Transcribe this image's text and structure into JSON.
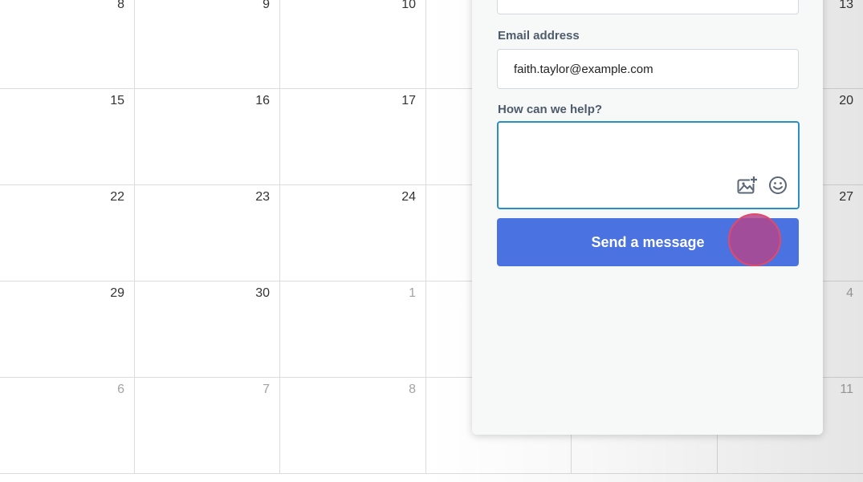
{
  "calendar": {
    "rows": [
      [
        {
          "day": "8",
          "muted": false
        },
        {
          "day": "9",
          "muted": false
        },
        {
          "day": "10",
          "muted": false
        },
        {
          "day": "",
          "muted": false
        },
        {
          "day": "",
          "muted": false
        },
        {
          "day": "13",
          "muted": false
        }
      ],
      [
        {
          "day": "15",
          "muted": false
        },
        {
          "day": "16",
          "muted": false
        },
        {
          "day": "17",
          "muted": false
        },
        {
          "day": "",
          "muted": false
        },
        {
          "day": "",
          "muted": false
        },
        {
          "day": "20",
          "muted": false
        }
      ],
      [
        {
          "day": "22",
          "muted": false
        },
        {
          "day": "23",
          "muted": false
        },
        {
          "day": "24",
          "muted": false
        },
        {
          "day": "",
          "muted": false
        },
        {
          "day": "",
          "muted": false
        },
        {
          "day": "27",
          "muted": false
        }
      ],
      [
        {
          "day": "29",
          "muted": false
        },
        {
          "day": "30",
          "muted": false
        },
        {
          "day": "1",
          "muted": true
        },
        {
          "day": "",
          "muted": true
        },
        {
          "day": "",
          "muted": true
        },
        {
          "day": "4",
          "muted": true
        }
      ],
      [
        {
          "day": "6",
          "muted": true
        },
        {
          "day": "7",
          "muted": true
        },
        {
          "day": "8",
          "muted": true
        },
        {
          "day": "",
          "muted": true
        },
        {
          "day": "",
          "muted": true
        },
        {
          "day": "11",
          "muted": true
        }
      ]
    ]
  },
  "contact_form": {
    "email_label": "Email address",
    "email_value": "faith.taylor@example.com",
    "help_label": "How can we help?",
    "message_value": "",
    "image_icon": "image-plus-icon",
    "emoji_icon": "emoji-icon",
    "send_label": "Send a message"
  },
  "colors": {
    "accent_button": "#4a72e0",
    "focus_border": "#2a8fc7",
    "click_marker": "#e24a6b"
  }
}
